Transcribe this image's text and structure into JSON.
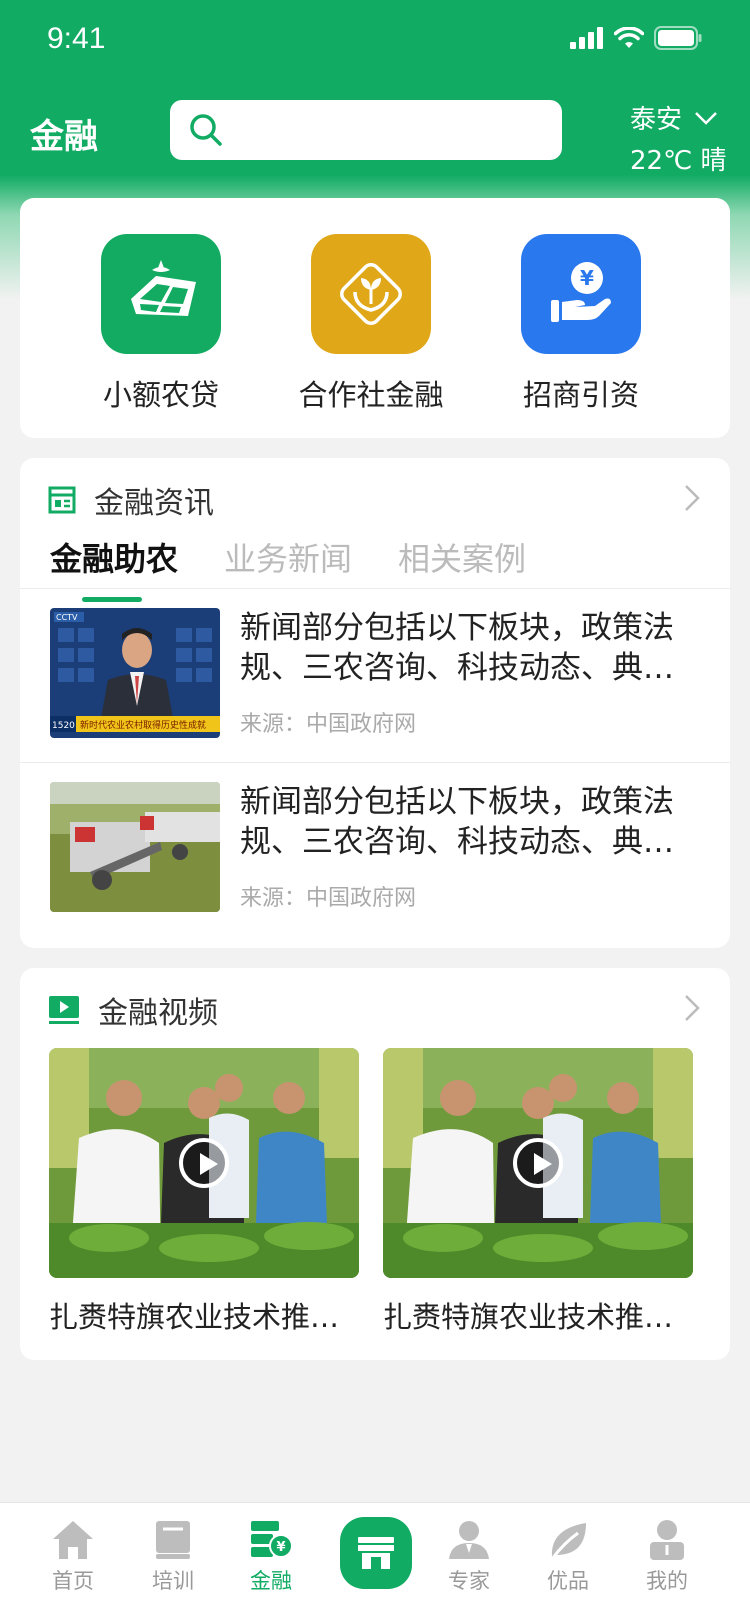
{
  "status_bar": {
    "time": "9:41"
  },
  "header": {
    "title": "金融",
    "search_placeholder": "",
    "location": {
      "city": "泰安",
      "weather": "22℃ 晴"
    }
  },
  "quick_actions": [
    {
      "label": "小额农贷",
      "icon": "farm-field-icon",
      "color": "#13ab62"
    },
    {
      "label": "合作社金融",
      "icon": "sprout-hands-icon",
      "color": "#e0a818"
    },
    {
      "label": "招商引资",
      "icon": "yuan-hand-icon",
      "color": "#2a78ee"
    }
  ],
  "news": {
    "title": "金融资讯",
    "tabs": [
      {
        "label": "金融助农",
        "active": true
      },
      {
        "label": "业务新闻",
        "active": false
      },
      {
        "label": "相关案例",
        "active": false
      }
    ],
    "items": [
      {
        "title": "新闻部分包括以下板块，政策法规、三农咨询、科技动态、典型案例",
        "source": "来源：中国政府网",
        "thumb_caption": "新时代农业农村取得历史性成就"
      },
      {
        "title": "新闻部分包括以下板块，政策法规、三农咨询、科技动态、典型案例",
        "source": "来源：中国政府网"
      }
    ]
  },
  "videos": {
    "title": "金融视频",
    "items": [
      {
        "title": "扎赉特旗农业技术推广中心"
      },
      {
        "title": "扎赉特旗农业技术推广中心"
      }
    ]
  },
  "tab_bar": {
    "items": [
      {
        "label": "首页",
        "icon": "home-icon",
        "active": false
      },
      {
        "label": "培训",
        "icon": "book-icon",
        "active": false
      },
      {
        "label": "金融",
        "icon": "finance-icon",
        "active": true
      },
      {
        "label": "",
        "icon": "store-icon",
        "active": false
      },
      {
        "label": "专家",
        "icon": "expert-icon",
        "active": false
      },
      {
        "label": "优品",
        "icon": "leaf-icon",
        "active": false
      },
      {
        "label": "我的",
        "icon": "profile-icon",
        "active": false
      }
    ]
  },
  "colors": {
    "primary": "#11ab64",
    "background": "#f2f2f2"
  }
}
